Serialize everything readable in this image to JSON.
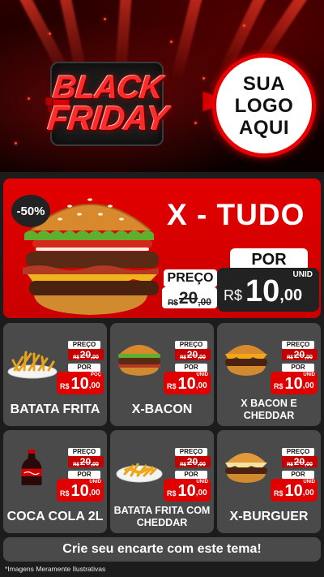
{
  "header": {
    "badge_line1": "BLACK",
    "badge_line2": "FRIDAY",
    "logo_line1": "SUA",
    "logo_line2": "LOGO",
    "logo_line3": "AQUI"
  },
  "featured": {
    "discount": "-50%",
    "title": "X - TUDO",
    "por_label": "POR",
    "preco_label": "PREÇO",
    "old_currency": "R$",
    "old_int": "20",
    "old_dec": ",00",
    "unid_label": "UNID",
    "new_currency": "R$",
    "new_int": "10",
    "new_dec": ",00"
  },
  "products": [
    {
      "name": "BATATA FRITA",
      "icon": "fries-icon",
      "preco_label": "PREÇO",
      "old_currency": "R$",
      "old_int": "20",
      "old_dec": ",00",
      "por_label": "POR",
      "unid_label": "POÇ",
      "new_currency": "R$",
      "new_int": "10",
      "new_dec": ",00"
    },
    {
      "name": "X-BACON",
      "icon": "burger-icon",
      "preco_label": "PREÇO",
      "old_currency": "R$",
      "old_int": "20",
      "old_dec": ",00",
      "por_label": "POR",
      "unid_label": "UNID",
      "new_currency": "R$",
      "new_int": "10",
      "new_dec": ",00"
    },
    {
      "name": "X BACON E CHEDDAR",
      "icon": "cheddar-burger-icon",
      "preco_label": "PREÇO",
      "old_currency": "R$",
      "old_int": "20",
      "old_dec": ",00",
      "por_label": "POR",
      "unid_label": "UNID",
      "new_currency": "R$",
      "new_int": "10",
      "new_dec": ",00"
    },
    {
      "name": "COCA COLA 2L",
      "icon": "soda-bottle-icon",
      "preco_label": "PREÇO",
      "old_currency": "R$",
      "old_int": "20",
      "old_dec": ",00",
      "por_label": "POR",
      "unid_label": "UNID",
      "new_currency": "R$",
      "new_int": "10",
      "new_dec": ",00"
    },
    {
      "name": "BATATA FRITA COM CHEDDAR",
      "icon": "cheddar-fries-icon",
      "preco_label": "PREÇO",
      "old_currency": "R$",
      "old_int": "20",
      "old_dec": ",00",
      "por_label": "POR",
      "unid_label": "UNID",
      "new_currency": "R$",
      "new_int": "10",
      "new_dec": ",00"
    },
    {
      "name": "X-BURGUER",
      "icon": "cheeseburger-icon",
      "preco_label": "PREÇO",
      "old_currency": "R$",
      "old_int": "20",
      "old_dec": ",00",
      "por_label": "POR",
      "unid_label": "UNID",
      "new_currency": "R$",
      "new_int": "10",
      "new_dec": ",00"
    }
  ],
  "footer": {
    "cta": "Crie seu encarte com este tema!",
    "disclaimer": "*Imagens Meramente Ilustrativas"
  },
  "colors": {
    "brand_red": "#e30000",
    "card_gray": "#4a4a4a",
    "page_bg": "#1c1c1c",
    "price_dark": "#222222"
  }
}
